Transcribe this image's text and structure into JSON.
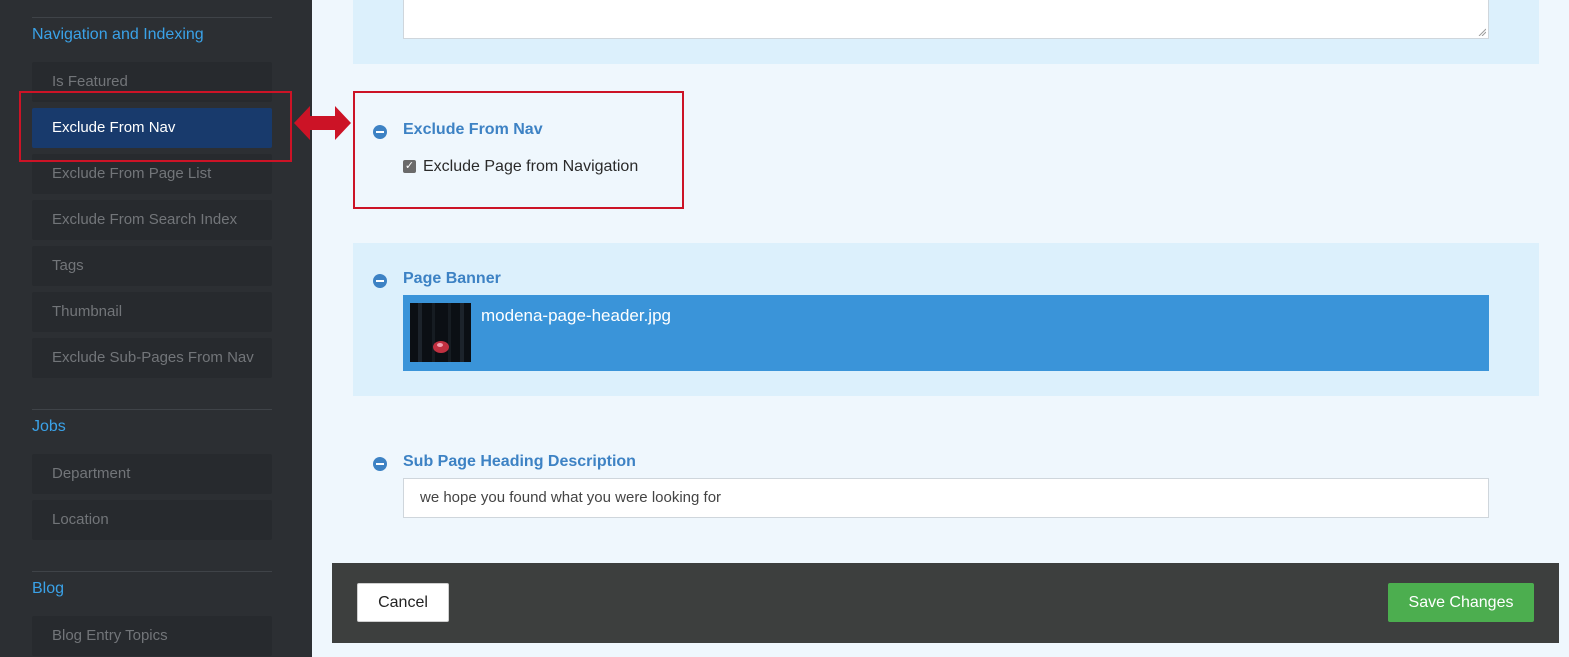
{
  "sidebar": {
    "groups": [
      {
        "label": "Navigation and Indexing",
        "items": [
          "Is Featured",
          "Exclude From Nav",
          "Exclude From Page List",
          "Exclude From Search Index",
          "Tags",
          "Thumbnail",
          "Exclude Sub-Pages From Nav"
        ]
      },
      {
        "label": "Jobs",
        "items": [
          "Department",
          "Location"
        ]
      },
      {
        "label": "Blog",
        "items": [
          "Blog Entry Topics"
        ]
      }
    ],
    "active_item": "Exclude From Nav"
  },
  "fields": {
    "exclude_nav": {
      "title": "Exclude From Nav",
      "checkbox_label": "Exclude Page from Navigation",
      "checked": true
    },
    "page_banner": {
      "title": "Page Banner",
      "filename": "modena-page-header.jpg"
    },
    "sub_heading": {
      "title": "Sub Page Heading Description",
      "value": "we hope you found what you were looking for"
    }
  },
  "footer": {
    "cancel_label": "Cancel",
    "save_label": "Save Changes"
  },
  "colors": {
    "sidebar_bg": "#2c2f33",
    "active_item_bg": "#183a6c",
    "accent_blue": "#3d82c4",
    "annotation_red": "#cc1326",
    "save_green": "#4cae4f"
  }
}
